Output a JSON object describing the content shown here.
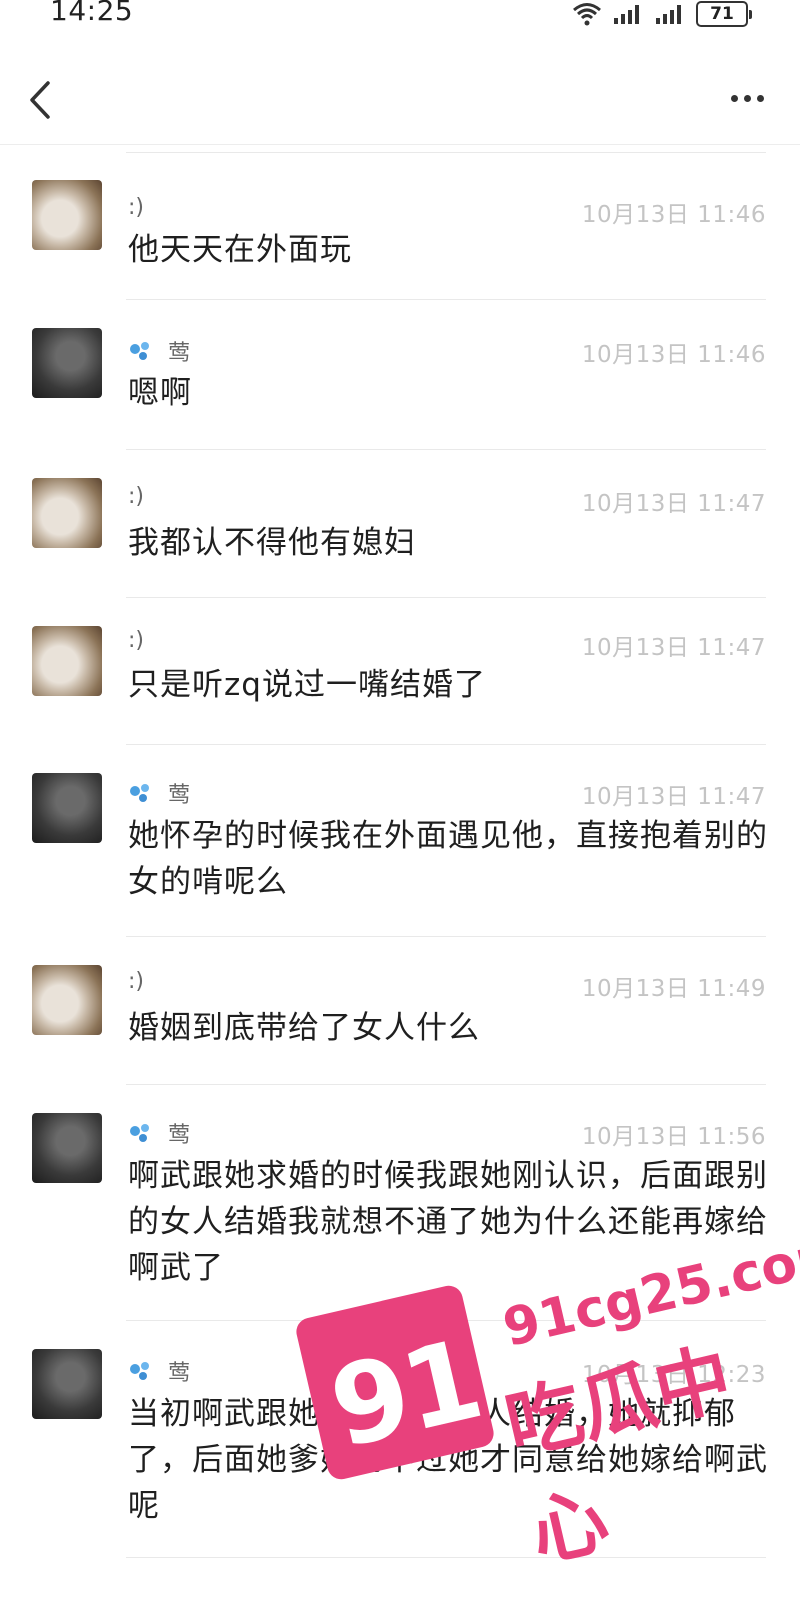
{
  "status_bar": {
    "time": "14:25",
    "battery": "71"
  },
  "nav": {
    "back_icon": "chevron-left-icon",
    "more_icon": "more-dots-icon"
  },
  "messages": [
    {
      "sender": ":)",
      "avatar": "cat",
      "has_icon": false,
      "time": "10月13日 11:46",
      "text": "他天天在外面玩"
    },
    {
      "sender": "莺",
      "avatar": "dark",
      "has_icon": true,
      "time": "10月13日 11:46",
      "text": "嗯啊"
    },
    {
      "sender": ":)",
      "avatar": "cat",
      "has_icon": false,
      "time": "10月13日 11:47",
      "text": "我都认不得他有媳妇"
    },
    {
      "sender": ":)",
      "avatar": "cat",
      "has_icon": false,
      "time": "10月13日 11:47",
      "text": "只是听zq说过一嘴结婚了"
    },
    {
      "sender": "莺",
      "avatar": "dark",
      "has_icon": true,
      "time": "10月13日 11:47",
      "text": "她怀孕的时候我在外面遇见他，直接抱着别的女的啃呢么"
    },
    {
      "sender": ":)",
      "avatar": "cat",
      "has_icon": false,
      "time": "10月13日 11:49",
      "text": "婚姻到底带给了女人什么"
    },
    {
      "sender": "莺",
      "avatar": "dark",
      "has_icon": true,
      "time": "10月13日 11:56",
      "text": "啊武跟她求婚的时候我跟她刚认识，后面跟别的女人结婚我就想不通了她为什么还能再嫁给啊武了"
    },
    {
      "sender": "莺",
      "avatar": "dark",
      "has_icon": true,
      "time": "10月13日 12:23",
      "text": "当初啊武跟她求完婚跟别人结婚，她就抑郁了，后面她爹妈拗不过她才同意给她嫁给啊武呢"
    }
  ],
  "watermark": {
    "big": "91",
    "domain": "91cg25.com",
    "name": "吃瓜中心"
  },
  "colors": {
    "accent": "#e8417c",
    "time_gray": "#c4c4c4",
    "divider": "#e9e9e9"
  }
}
